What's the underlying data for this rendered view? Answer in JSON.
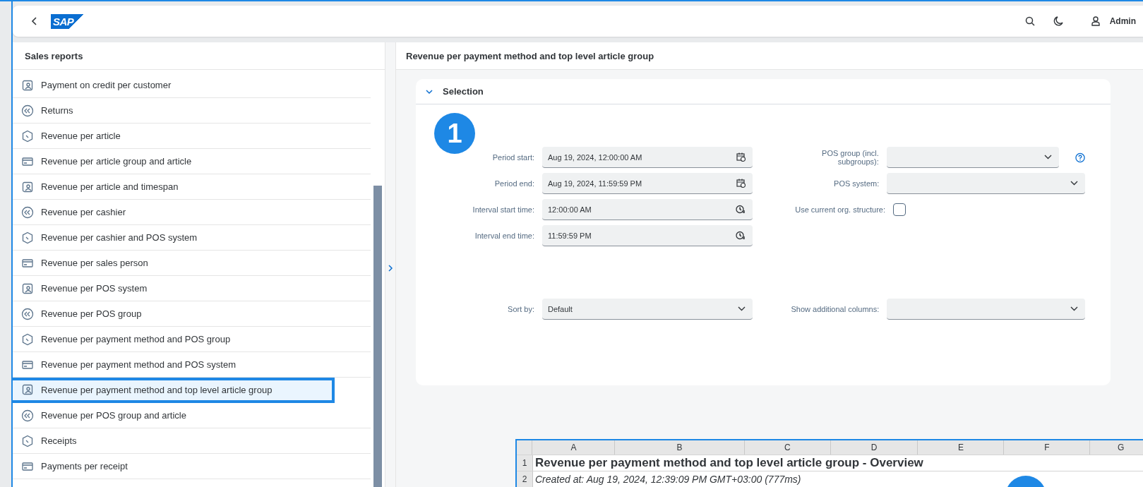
{
  "header": {
    "logo": "SAP",
    "user": "Admin"
  },
  "sidebar": {
    "title": "Sales reports",
    "items": [
      {
        "label": "Payment on credit per customer",
        "selected": false
      },
      {
        "label": "Returns",
        "selected": false
      },
      {
        "label": "Revenue per article",
        "selected": false
      },
      {
        "label": "Revenue per article group and article",
        "selected": false
      },
      {
        "label": "Revenue per article and timespan",
        "selected": false
      },
      {
        "label": "Revenue per cashier",
        "selected": false
      },
      {
        "label": "Revenue per cashier and POS system",
        "selected": false
      },
      {
        "label": "Revenue per sales person",
        "selected": false
      },
      {
        "label": "Revenue per POS system",
        "selected": false
      },
      {
        "label": "Revenue per POS group",
        "selected": false
      },
      {
        "label": "Revenue per payment method and POS group",
        "selected": false
      },
      {
        "label": "Revenue per payment method and POS system",
        "selected": false
      },
      {
        "label": "Revenue per payment method and top level article group",
        "selected": true
      },
      {
        "label": "Revenue per POS group and article",
        "selected": false
      },
      {
        "label": "Receipts",
        "selected": false
      },
      {
        "label": "Payments per receipt",
        "selected": false
      }
    ]
  },
  "page": {
    "title": "Revenue per payment method and top level article group"
  },
  "selection": {
    "title": "Selection",
    "expanded": true,
    "left_fields": [
      {
        "label": "Period start:",
        "value": "Aug 19, 2024, 12:00:00 AM",
        "kind": "date"
      },
      {
        "label": "Period end:",
        "value": "Aug 19, 2024, 11:59:59 PM",
        "kind": "date"
      },
      {
        "label": "Interval start time:",
        "value": "12:00:00 AM",
        "kind": "time"
      },
      {
        "label": "Interval end time:",
        "value": "11:59:59 PM",
        "kind": "time"
      }
    ],
    "right_fields": [
      {
        "label": "POS group (incl. subgroups):",
        "kind": "select",
        "help": true
      },
      {
        "label": "POS system:",
        "kind": "select",
        "help": false
      },
      {
        "label": "Use current org. structure:",
        "kind": "checkbox",
        "checked": false
      }
    ],
    "sort": {
      "label": "Sort by:",
      "value": "Default"
    },
    "columns": {
      "label": "Show additional columns:"
    }
  },
  "callouts": [
    "1"
  ],
  "spreadsheet": {
    "columns": [
      "A",
      "B",
      "C",
      "D",
      "E",
      "F",
      "G"
    ],
    "rows": [
      {
        "number": "1",
        "text": "Revenue per payment method and top level article group - Overview",
        "kind": "title"
      },
      {
        "number": "2",
        "text": "Created at: Aug 19, 2024, 12:39:09 PM GMT+03:00 (777ms)",
        "kind": "note"
      }
    ]
  }
}
